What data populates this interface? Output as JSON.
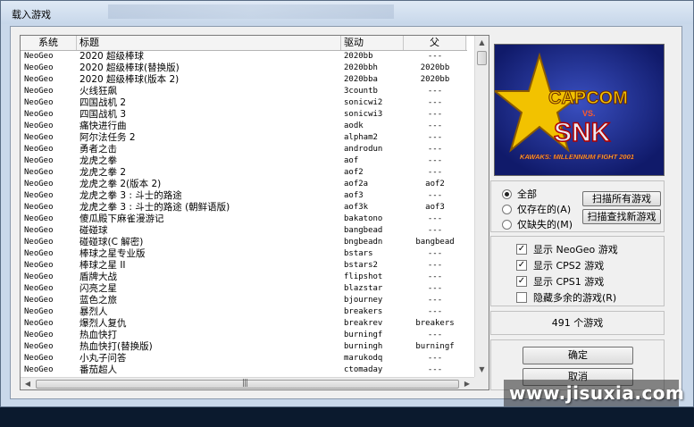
{
  "window": {
    "title": "载入游戏"
  },
  "list": {
    "headers": {
      "system": "系统",
      "title": "标题",
      "driver": "驱动",
      "parent": "父"
    },
    "rows": [
      {
        "system": "NeoGeo",
        "title": "2020 超级棒球",
        "driver": "2020bb",
        "parent": "---"
      },
      {
        "system": "NeoGeo",
        "title": "2020 超级棒球(替换版)",
        "driver": "2020bbh",
        "parent": "2020bb"
      },
      {
        "system": "NeoGeo",
        "title": "2020 超级棒球(版本 2)",
        "driver": "2020bba",
        "parent": "2020bb"
      },
      {
        "system": "NeoGeo",
        "title": "火线狂飙",
        "driver": "3countb",
        "parent": "---"
      },
      {
        "system": "NeoGeo",
        "title": "四国战机 2",
        "driver": "sonicwi2",
        "parent": "---"
      },
      {
        "system": "NeoGeo",
        "title": "四国战机 3",
        "driver": "sonicwi3",
        "parent": "---"
      },
      {
        "system": "NeoGeo",
        "title": "痛快进行曲",
        "driver": "aodk",
        "parent": "---"
      },
      {
        "system": "NeoGeo",
        "title": "阿尔法任务 2",
        "driver": "alpham2",
        "parent": "---"
      },
      {
        "system": "NeoGeo",
        "title": "勇者之击",
        "driver": "androdun",
        "parent": "---"
      },
      {
        "system": "NeoGeo",
        "title": "龙虎之拳",
        "driver": "aof",
        "parent": "---"
      },
      {
        "system": "NeoGeo",
        "title": "龙虎之拳 2",
        "driver": "aof2",
        "parent": "---"
      },
      {
        "system": "NeoGeo",
        "title": "龙虎之拳 2(版本 2)",
        "driver": "aof2a",
        "parent": "aof2"
      },
      {
        "system": "NeoGeo",
        "title": "龙虎之拳 3 : 斗士的路途",
        "driver": "aof3",
        "parent": "---"
      },
      {
        "system": "NeoGeo",
        "title": "龙虎之拳 3 : 斗士的路途 (朝鲜语版)",
        "driver": "aof3k",
        "parent": "aof3"
      },
      {
        "system": "NeoGeo",
        "title": "傻瓜殿下麻雀漫游记",
        "driver": "bakatono",
        "parent": "---"
      },
      {
        "system": "NeoGeo",
        "title": "碰碰球",
        "driver": "bangbead",
        "parent": "---"
      },
      {
        "system": "NeoGeo",
        "title": "碰碰球(C 解密)",
        "driver": "bngbeadn",
        "parent": "bangbead"
      },
      {
        "system": "NeoGeo",
        "title": "棒球之星专业版",
        "driver": "bstars",
        "parent": "---"
      },
      {
        "system": "NeoGeo",
        "title": "棒球之星 II",
        "driver": "bstars2",
        "parent": "---"
      },
      {
        "system": "NeoGeo",
        "title": "盾牌大战",
        "driver": "flipshot",
        "parent": "---"
      },
      {
        "system": "NeoGeo",
        "title": "闪亮之星",
        "driver": "blazstar",
        "parent": "---"
      },
      {
        "system": "NeoGeo",
        "title": "蓝色之旅",
        "driver": "bjourney",
        "parent": "---"
      },
      {
        "system": "NeoGeo",
        "title": "暴烈人",
        "driver": "breakers",
        "parent": "---"
      },
      {
        "system": "NeoGeo",
        "title": "爆烈人复仇",
        "driver": "breakrev",
        "parent": "breakers"
      },
      {
        "system": "NeoGeo",
        "title": "热血快打",
        "driver": "burningf",
        "parent": "---"
      },
      {
        "system": "NeoGeo",
        "title": "热血快打(替换版)",
        "driver": "burningh",
        "parent": "burningf"
      },
      {
        "system": "NeoGeo",
        "title": "小丸子问答",
        "driver": "marukodq",
        "parent": "---"
      },
      {
        "system": "NeoGeo",
        "title": "番茄超人",
        "driver": "ctomaday",
        "parent": "---"
      }
    ]
  },
  "logo": {
    "brand1": "CAPCOM",
    "vs": "VS.",
    "brand2": "SNK",
    "subtitle": "KAWAKS: MILLENNIUM FIGHT 2001",
    "colors": {
      "bg": "#1c2d93",
      "star": "#f2c200",
      "capcom": "#f2c200",
      "snk": "#e8eaf4",
      "subtitle": "#ffd84a"
    }
  },
  "filter": {
    "options": [
      {
        "label": "全部",
        "checked": true
      },
      {
        "label": "仅存在的(A)",
        "checked": false
      },
      {
        "label": "仅缺失的(M)",
        "checked": false
      }
    ],
    "scan_all_label": "扫描所有游戏",
    "scan_new_label": "扫描查找新游戏"
  },
  "display": {
    "options": [
      {
        "label": "显示 NeoGeo 游戏",
        "checked": true
      },
      {
        "label": "显示 CPS2 游戏",
        "checked": true
      },
      {
        "label": "显示 CPS1 游戏",
        "checked": true
      },
      {
        "label": "隐藏多余的游戏(R)",
        "checked": false
      }
    ]
  },
  "count": {
    "label": "491 个游戏"
  },
  "buttons": {
    "ok": "确定",
    "cancel": "取消"
  },
  "watermark": "www.jisuxia.com"
}
